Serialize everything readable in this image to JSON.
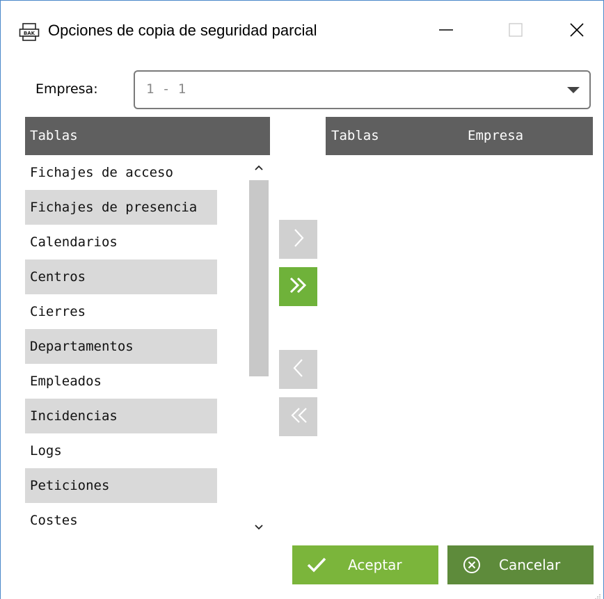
{
  "window": {
    "title": "Opciones de copia de seguridad parcial",
    "icons": {
      "app": "backup-file-icon",
      "minimize": "minimize-icon",
      "maximize": "maximize-icon",
      "close": "close-icon"
    }
  },
  "company": {
    "label": "Empresa:",
    "selected": "1 - 1",
    "icon": "chevron-down-icon"
  },
  "left_panel": {
    "header": "Tablas",
    "items": [
      {
        "label": "Fichajes de acceso"
      },
      {
        "label": "Fichajes de presencia"
      },
      {
        "label": "Calendarios"
      },
      {
        "label": "Centros"
      },
      {
        "label": "Cierres"
      },
      {
        "label": "Departamentos"
      },
      {
        "label": "Empleados"
      },
      {
        "label": "Incidencias"
      },
      {
        "label": "Logs"
      },
      {
        "label": "Peticiones"
      },
      {
        "label": "Costes"
      }
    ],
    "scroll_fraction_visible": 0.51
  },
  "move_buttons": {
    "add_one": {
      "icon": "chevron-right-icon",
      "enabled": false
    },
    "add_all": {
      "icon": "double-chevron-right-icon",
      "enabled": true
    },
    "remove_one": {
      "icon": "chevron-left-icon",
      "enabled": false
    },
    "remove_all": {
      "icon": "double-chevron-left-icon",
      "enabled": false
    }
  },
  "right_panel": {
    "headers": [
      "Tablas",
      "Empresa"
    ],
    "items": []
  },
  "actions": {
    "accept": {
      "label": "Aceptar",
      "icon": "check-icon"
    },
    "cancel": {
      "label": "Cancelar",
      "icon": "cancel-circle-icon"
    }
  },
  "colors": {
    "header_bg": "#5f5f5f",
    "row_alt": "#d9d9d9",
    "accent_green": "#6fb23a",
    "accept_green": "#7bb53b",
    "cancel_green": "#5e8b3b",
    "disabled_gray": "#d0d0d0",
    "window_border": "#4a87c9"
  }
}
